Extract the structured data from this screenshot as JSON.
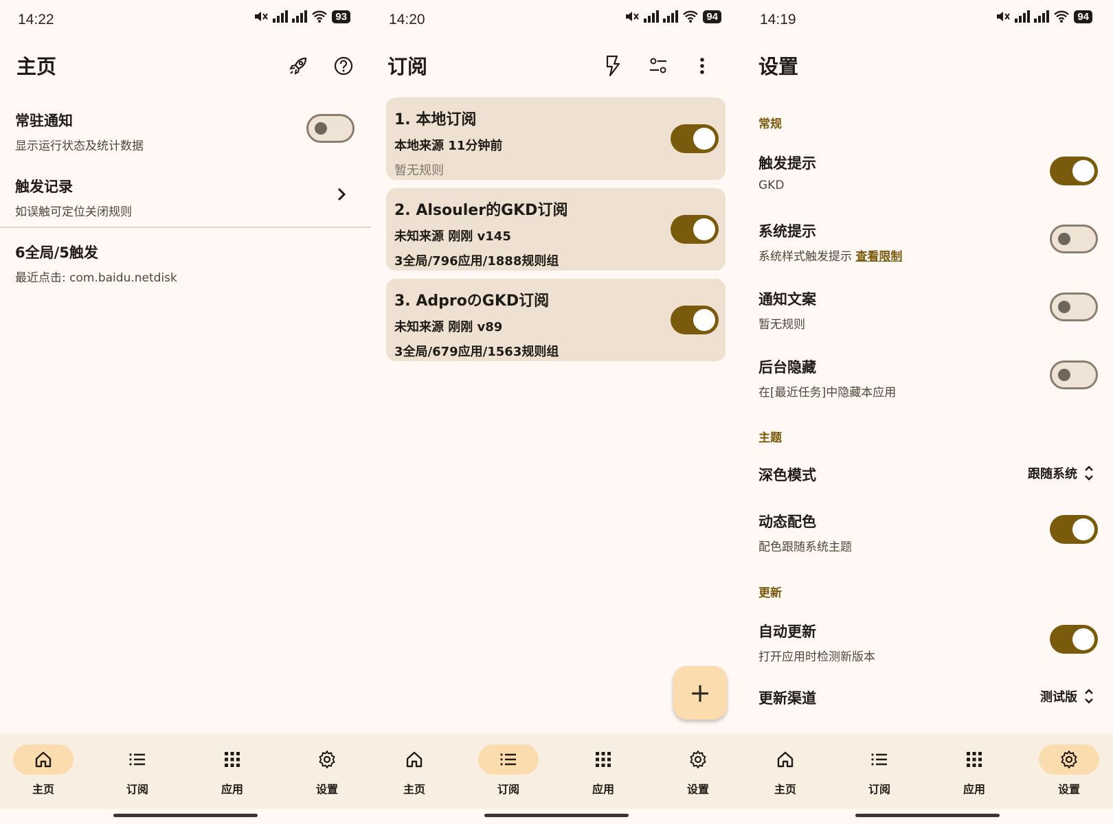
{
  "home": {
    "time": "14:22",
    "battery": "93",
    "title": "主页",
    "rows": [
      {
        "title": "常驻通知",
        "subtitle": "显示运行状态及统计数据"
      },
      {
        "title": "触发记录",
        "subtitle": "如误触可定位关闭规则"
      },
      {
        "title": "6全局/5触发",
        "subtitle": "最近点击: com.baidu.netdisk"
      }
    ]
  },
  "subs": {
    "time": "14:20",
    "battery": "94",
    "title": "订阅",
    "cards": [
      {
        "title": "1. 本地订阅",
        "line1": "本地来源   11分钟前",
        "line2": "暂无规则"
      },
      {
        "title": "2. Alsouler的GKD订阅",
        "line1": "未知来源   刚刚   v145",
        "line2": "3全局/796应用/1888规则组"
      },
      {
        "title": "3. AdproのGKD订阅",
        "line1": "未知来源   刚刚   v89",
        "line2": "3全局/679应用/1563规则组"
      }
    ],
    "fab": "+"
  },
  "settings": {
    "time": "14:19",
    "battery": "94",
    "title": "设置",
    "sections": {
      "general": "常规",
      "theme": "主题",
      "update": "更新"
    },
    "trigger_tip": {
      "title": "触发提示",
      "subtitle": "GKD"
    },
    "system_tip": {
      "title": "系统提示",
      "subtitle": "系统样式触发提示 ",
      "link": "查看限制"
    },
    "notify_text": {
      "title": "通知文案",
      "subtitle": "暂无规则"
    },
    "bg_hide": {
      "title": "后台隐藏",
      "subtitle": "在[最近任务]中隐藏本应用"
    },
    "dark_mode": {
      "title": "深色模式",
      "value": "跟随系统"
    },
    "dynamic_color": {
      "title": "动态配色",
      "subtitle": "配色跟随系统主题"
    },
    "auto_update": {
      "title": "自动更新",
      "subtitle": "打开应用时检测新版本"
    },
    "update_channel": {
      "title": "更新渠道",
      "value": "测试版"
    }
  },
  "nav": {
    "home": "主页",
    "subs": "订阅",
    "apps": "应用",
    "settings": "设置"
  },
  "colors": {
    "accent": "#7a5a0c",
    "background": "#fff8f4",
    "card": "#efe1d2",
    "nav_active": "#fbdcae"
  }
}
